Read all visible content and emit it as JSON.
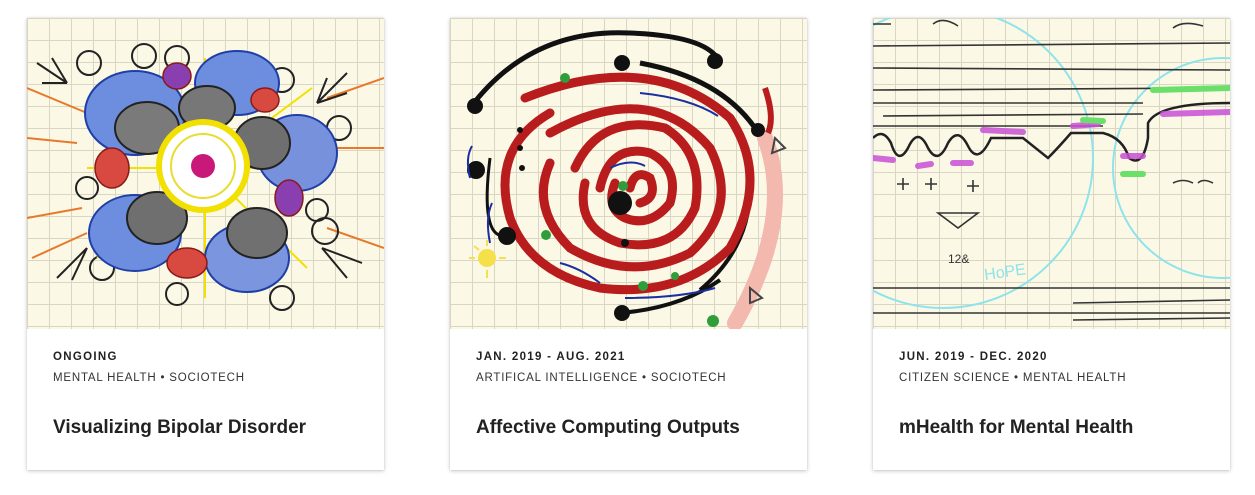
{
  "cards": [
    {
      "date": "ONGOING",
      "tags": "MENTAL HEALTH • SOCIOTECH",
      "title": "Visualizing Bipolar Disorder"
    },
    {
      "date": "JAN. 2019 - AUG. 2021",
      "tags": "ARTIFICAL INTELLIGENCE • SOCIOTECH",
      "title": "Affective Computing Outputs"
    },
    {
      "date": "JUN. 2019 - DEC. 2020",
      "tags": "CITIZEN SCIENCE • MENTAL HEALTH",
      "title": "mHealth for Mental Health"
    }
  ],
  "drawing_text": {
    "hope": "HoPE",
    "number": "12&"
  }
}
